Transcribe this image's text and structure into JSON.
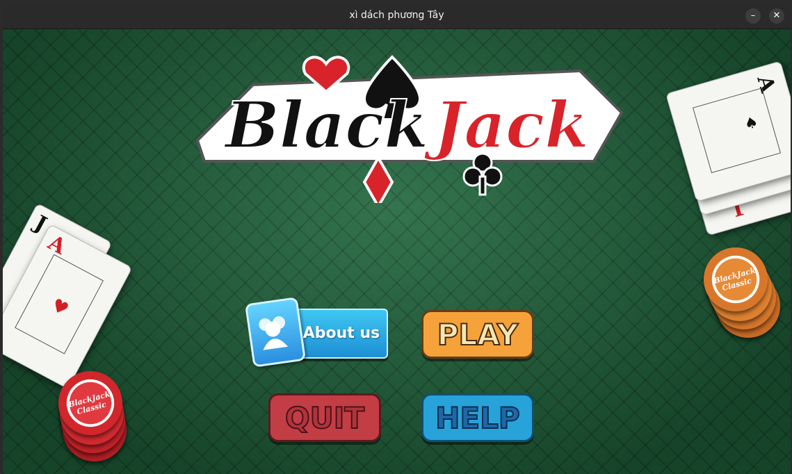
{
  "window": {
    "title": "xì dách phương Tây",
    "minimize_glyph": "–",
    "close_glyph": "✕"
  },
  "logo": {
    "word1": "Black",
    "word2": "Jack"
  },
  "cards": {
    "left_back": "J",
    "left_front": "A",
    "right_back": "A",
    "right_front": "A",
    "right_bottom": "J"
  },
  "chips": {
    "left_label": "BlackJack Classic",
    "right_label": "BlackJack Classic"
  },
  "menu": {
    "about_label": "About us",
    "play_label": "PLAY",
    "quit_label": "QUIT",
    "help_label": "HELP"
  },
  "colors": {
    "felt": "#22683f",
    "logo_red": "#d8232a",
    "logo_black": "#111111",
    "about": "#1d8fd3",
    "play": "#f5a23a",
    "quit": "#c33d45",
    "help": "#27a3d9"
  }
}
